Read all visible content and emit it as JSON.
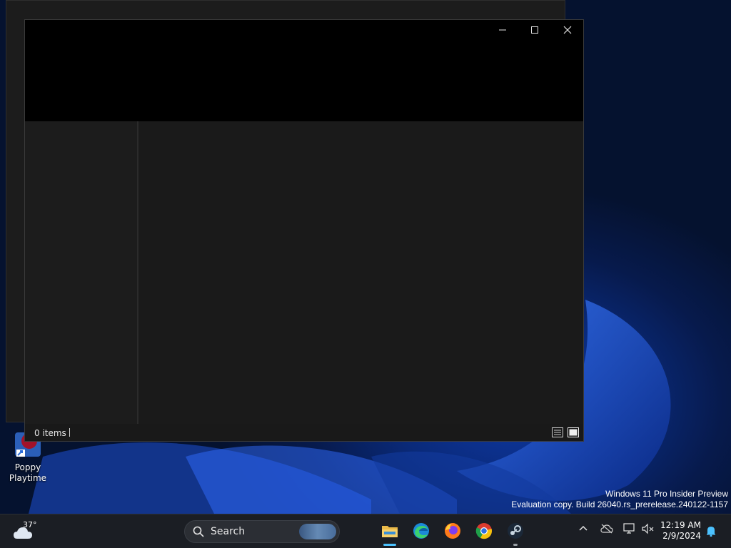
{
  "desktop": {
    "icons": [
      {
        "label_line1": "Poppy",
        "label_line2": "Playtime"
      }
    ],
    "watermark": {
      "line1": "Windows 11 Pro Insider Preview",
      "line2": "Evaluation copy. Build 26040.rs_prerelease.240122-1157"
    }
  },
  "explorer": {
    "status": {
      "item_count": "0 items"
    },
    "window_buttons": [
      "minimize-icon",
      "maximize-icon",
      "close-icon"
    ],
    "view_buttons": [
      "details-view-icon",
      "large-icons-view-icon"
    ]
  },
  "taskbar": {
    "weather": {
      "temperature": "37°",
      "icon": "cloud-icon"
    },
    "search": {
      "label": "Search"
    },
    "apps": [
      {
        "name": "file-explorer-icon",
        "active": true
      },
      {
        "name": "edge-icon",
        "active": false
      },
      {
        "name": "firefox-icon",
        "active": false
      },
      {
        "name": "chrome-icon",
        "active": false
      },
      {
        "name": "steam-icon",
        "active": false,
        "running": true
      }
    ],
    "tray": {
      "time": "12:19 AM",
      "date": "2/9/2024"
    }
  },
  "colors": {
    "accent": "#4cc2ff",
    "titlebar": "#000000",
    "content": "#1a1a1a"
  }
}
